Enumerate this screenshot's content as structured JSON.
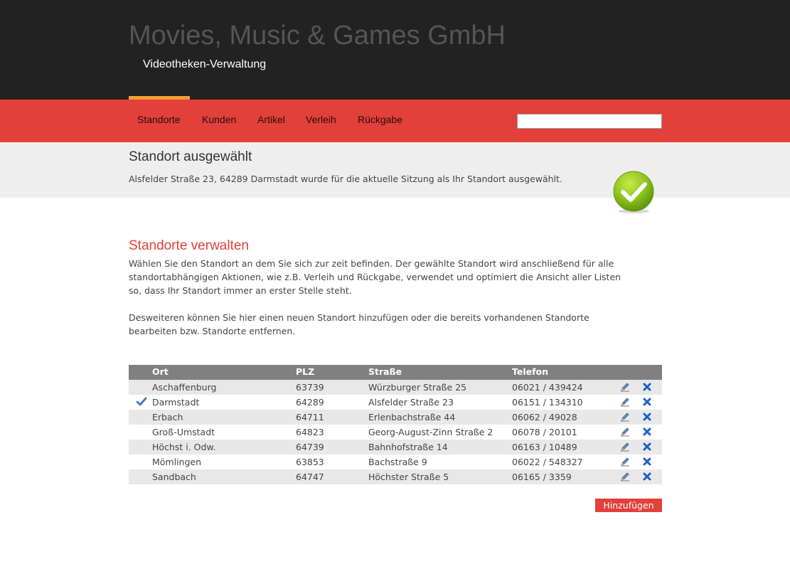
{
  "header": {
    "title": "Movies, Music & Games GmbH",
    "subtitle": "Videotheken-Verwaltung"
  },
  "nav": {
    "items": [
      "Standorte",
      "Kunden",
      "Artikel",
      "Verleih",
      "Rückgabe"
    ],
    "active": "Standorte",
    "search": {
      "value": "",
      "placeholder": ""
    }
  },
  "notice": {
    "title": "Standort ausgewählt",
    "text": "Alsfelder Straße 23, 64289 Darmstadt wurde für die aktuelle Sitzung als Ihr Standort ausgewählt.",
    "icon": "check-success-icon"
  },
  "main": {
    "title": "Standorte verwalten",
    "paragraph1": [
      "Wählen Sie den Standort an dem Sie sich zur zeit befinden. Der gewählte Standort wird anschließend für alle",
      "standortabhängigen Aktionen, wie z.B. Verleih und Rückgabe, verwendet und optimiert die Ansicht aller Listen",
      "so, dass Ihr Standort immer an erster Stelle steht."
    ],
    "paragraph2": [
      "Desweiteren können Sie hier einen neuen Standort hinzufügen oder die bereits vorhandenen Standorte",
      "bearbeiten bzw. Standorte entfernen."
    ]
  },
  "table": {
    "columns": [
      "Ort",
      "PLZ",
      "Straße",
      "Telefon"
    ],
    "rows": [
      {
        "ort": "Aschaffenburg",
        "plz": "63739",
        "strasse": "Würzburger Straße 25",
        "telefon": "06021 / 439424",
        "selected": false
      },
      {
        "ort": "Darmstadt",
        "plz": "64289",
        "strasse": "Alsfelder Straße 23",
        "telefon": "06151 / 134310",
        "selected": true
      },
      {
        "ort": "Erbach",
        "plz": "64711",
        "strasse": "Erlenbachstraße 44",
        "telefon": "06062 / 49028",
        "selected": false
      },
      {
        "ort": "Groß-Umstadt",
        "plz": "64823",
        "strasse": "Georg-August-Zinn Straße 2",
        "telefon": "06078 / 20101",
        "selected": false
      },
      {
        "ort": "Höchst i. Odw.",
        "plz": "64739",
        "strasse": "Bahnhofstraße 14",
        "telefon": "06163 / 10489",
        "selected": false
      },
      {
        "ort": "Mömlingen",
        "plz": "63853",
        "strasse": "Bachstraße 9",
        "telefon": "06022 / 548327",
        "selected": false
      },
      {
        "ort": "Sandbach",
        "plz": "64747",
        "strasse": "Höchster Straße 5",
        "telefon": "06165 / 3359",
        "selected": false
      }
    ],
    "row_icons": {
      "edit": "pencil-edit-icon",
      "delete": "close-x-icon",
      "selected": "checkmark-icon"
    }
  },
  "actions": {
    "add_label": "Hinzufügen"
  },
  "colors": {
    "header_bg": "#222222",
    "accent_red": "#e2403a",
    "active_orange": "#f0a030",
    "notice_bg": "#eeeeee",
    "delete_blue": "#1a5fc8"
  }
}
